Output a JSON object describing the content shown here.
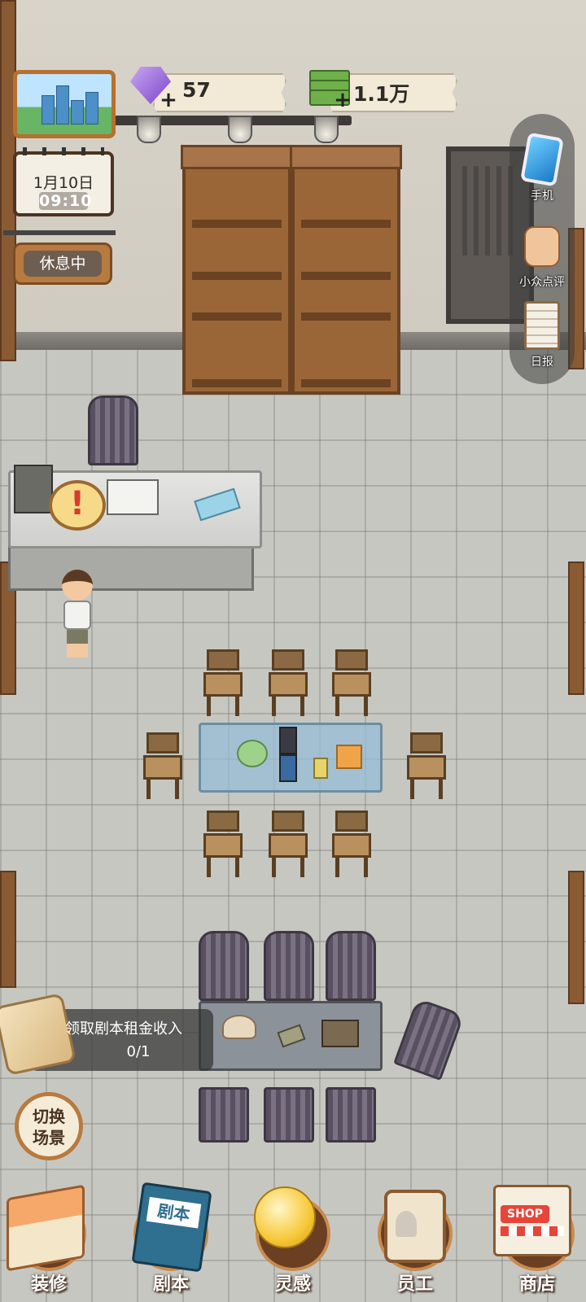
{
  "hud": {
    "gems": "57",
    "cash": "1.1万"
  },
  "calendar": {
    "date": "1月10日",
    "time": "09:10"
  },
  "status": {
    "label": "休息中"
  },
  "side_menu": {
    "items": [
      {
        "label": "手机",
        "icon": "phone-icon"
      },
      {
        "label": "小众点评",
        "icon": "thumbs-up-icon"
      },
      {
        "label": "日报",
        "icon": "daily-report-icon"
      }
    ]
  },
  "task": {
    "title": "领取剧本租金收入",
    "progress": "0/1"
  },
  "scene_switch": {
    "label": "切换场景"
  },
  "bottom_nav": {
    "items": [
      {
        "label": "装修",
        "icon": "house-icon"
      },
      {
        "label": "剧本",
        "icon": "script-book-icon"
      },
      {
        "label": "灵感",
        "icon": "lightbulb-icon"
      },
      {
        "label": "员工",
        "icon": "staff-card-icon"
      },
      {
        "label": "商店",
        "icon": "shop-icon"
      }
    ]
  },
  "book_label": "剧本",
  "shop_sign": "SHOP"
}
